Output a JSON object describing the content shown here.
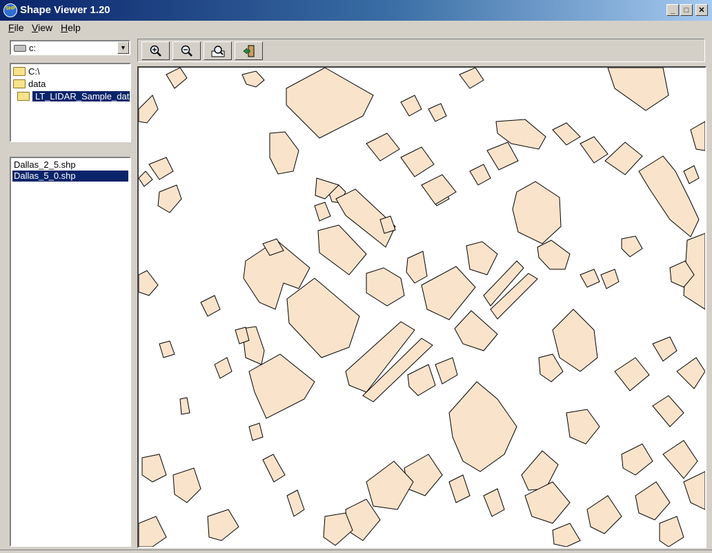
{
  "window": {
    "title": "Shape Viewer 1.20",
    "icon_text": "SHP"
  },
  "window_buttons": {
    "minimize": "_",
    "maximize": "□",
    "close": "✕"
  },
  "menu": [
    {
      "label": "File",
      "accel": "F",
      "rest": "ile"
    },
    {
      "label": "View",
      "accel": "V",
      "rest": "iew"
    },
    {
      "label": "Help",
      "accel": "H",
      "rest": "elp"
    }
  ],
  "drive": {
    "value": "c:",
    "icon": "drive-icon",
    "dropdown_icon": "chevron-down-icon"
  },
  "directories": [
    "C:\\",
    "data",
    "LT_LIDAR_Sample_data"
  ],
  "selected_directory": "LT_LIDAR_Sample_data",
  "files": [
    "Dallas_2_5.shp",
    "Dallas_5_0.shp"
  ],
  "selected_file": "Dallas_5_0.shp",
  "toolbar": [
    {
      "name": "zoom-in-button",
      "icon": "zoom-in-icon"
    },
    {
      "name": "zoom-out-button",
      "icon": "zoom-out-icon"
    },
    {
      "name": "zoom-extent-button",
      "icon": "map-extent-icon"
    },
    {
      "name": "exit-button",
      "icon": "exit-door-icon"
    }
  ],
  "colors": {
    "polygon_fill": "#fae3cb",
    "polygon_stroke": "#000000",
    "map_background": "#ffffff",
    "title_bar": "#0a246a",
    "selection": "#0a246a"
  }
}
